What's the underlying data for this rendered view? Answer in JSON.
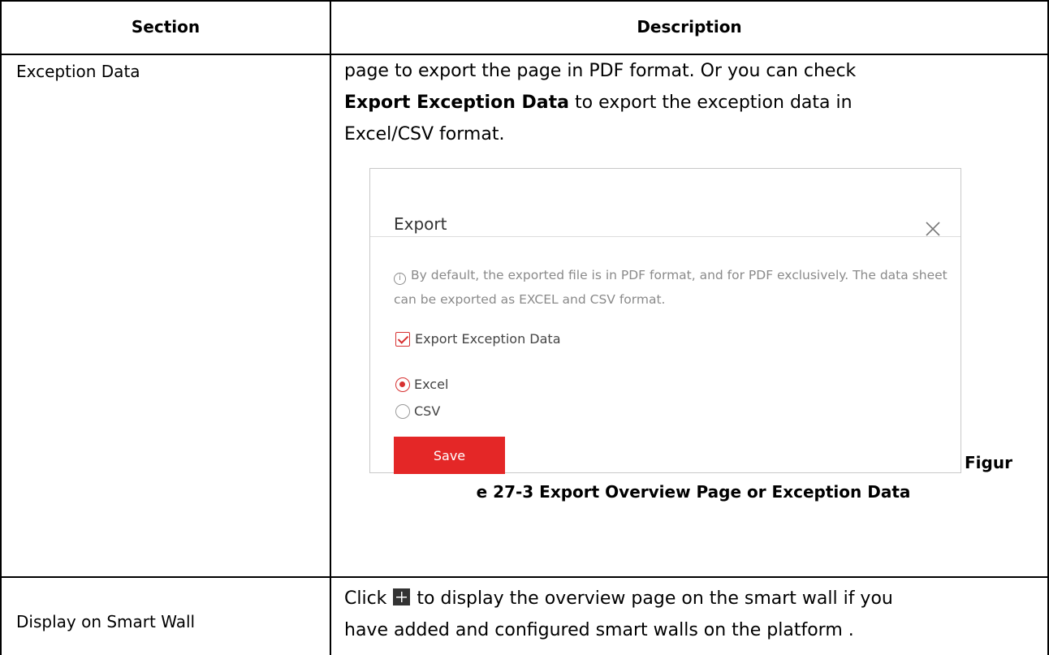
{
  "table": {
    "headers": [
      "Section",
      "Description"
    ],
    "rows": [
      {
        "section": "Exception Data",
        "desc_line1": "page to export the page in PDF format. Or you can check",
        "desc_bold": "Export Exception Data",
        "desc_line2_rest": " to export the exception data in",
        "desc_line3": "Excel/CSV format."
      },
      {
        "section": "Display on Smart Wall",
        "desc_click": "Click",
        "desc_after_icon": "to display the overview page on the smart wall if you",
        "desc_line2": "have added and configured smart walls on the platform ."
      }
    ]
  },
  "dialog": {
    "title": "Export",
    "info": "By default, the exported file is in PDF format, and for PDF exclusively. The data sheet can be exported as EXCEL and CSV format.",
    "info_icon": "i",
    "checkbox_label": "Export Exception Data",
    "checkbox_checked": true,
    "radio_options": [
      "Excel",
      "CSV"
    ],
    "radio_selected": "Excel",
    "save_label": "Save",
    "accent_color": "#e42727"
  },
  "caption": {
    "part1": "Figur",
    "part2": "e 27-3 Export Overview Page or Exception Data"
  },
  "icons": {
    "close": "close-icon",
    "info": "info-icon",
    "smart_wall": "smart-wall-icon"
  }
}
